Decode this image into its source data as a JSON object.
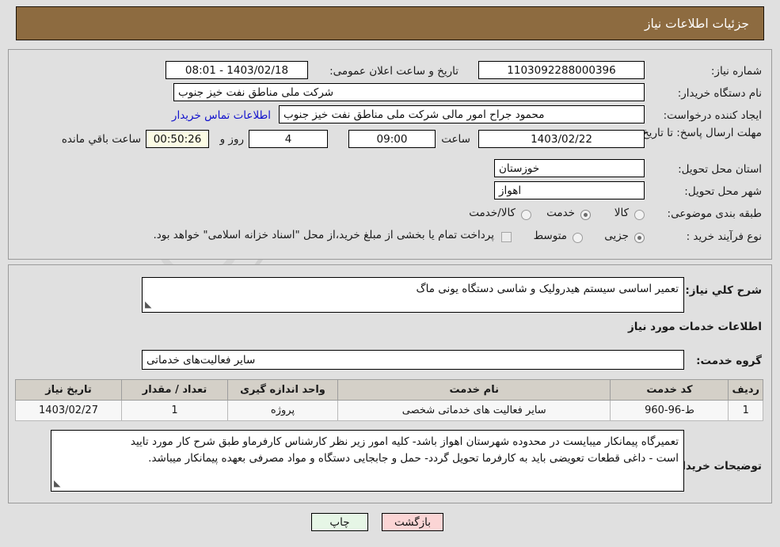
{
  "header": {
    "title": "جزئیات اطلاعات نیاز"
  },
  "top_section": {
    "need_number": {
      "label": "شماره نیاز:",
      "value": "1103092288000396"
    },
    "public_announce": {
      "label": "تاریخ و ساعت اعلان عمومی:",
      "value": "1403/02/18 - 08:01"
    },
    "buyer_org": {
      "label": "نام دستگاه خریدار:",
      "value": "شرکت ملی مناطق نفت خیز جنوب"
    },
    "request_creator": {
      "label": "ایجاد کننده درخواست:",
      "value": "محمود جراح امور مالی شرکت ملی مناطق نفت خیز جنوب"
    },
    "buyer_contact_link": "اطلاعات تماس خریدار",
    "deadline": {
      "label": "مهلت ارسال پاسخ: تا تاریخ:",
      "date": "1403/02/22",
      "time_label": "ساعت",
      "time": "09:00",
      "days": "4",
      "days_label": "روز و",
      "countdown": "00:50:26",
      "countdown_label": "ساعت باقي مانده"
    },
    "province": {
      "label": "استان محل تحویل:",
      "value": "خوزستان"
    },
    "city": {
      "label": "شهر محل تحویل:",
      "value": "اهواز"
    },
    "category": {
      "label": "طبقه بندی موضوعی:",
      "options": [
        "کالا",
        "خدمت",
        "کالا/خدمت"
      ],
      "selected": "خدمت"
    },
    "purchase_type": {
      "label": "نوع فرآیند خرید :",
      "options": [
        "جزیی",
        "متوسط"
      ],
      "selected": "جزیی"
    },
    "treasury_note": {
      "checked": false,
      "text": "پرداخت تمام یا بخشی از مبلغ خرید،از محل \"اسناد خزانه اسلامی\" خواهد بود."
    }
  },
  "bottom_section": {
    "general_desc": {
      "label": "شرح کلي نياز:",
      "value": "تعمیر اساسی سیستم هیدرولیک و شاسی دستگاه یونی ماگ"
    },
    "services_heading": "اطلاعات خدمات مورد نیاز",
    "service_group": {
      "label": "گروه خدمت:",
      "value": "سایر فعالیت‌های خدماتی"
    },
    "table": {
      "columns": [
        "ردیف",
        "کد خدمت",
        "نام خدمت",
        "واحد اندازه گیری",
        "تعداد / مقدار",
        "تاریخ نیاز"
      ],
      "rows": [
        {
          "row_no": "1",
          "service_code": "ط-96-960",
          "service_name": "سایر فعالیت های خدماتی شخصی",
          "unit": "پروژه",
          "quantity": "1",
          "need_date": "1403/02/27"
        }
      ]
    },
    "buyer_notes": {
      "label": "توضیحات خریدار:",
      "line1": "تعمیرگاه پیمانکار میبایست در محدوده شهرستان اهواز باشد- کلیه امور زیر نظر کارشناس کارفرماو طبق شرح کار مورد تایید",
      "line2": "است - داغی قطعات تعویضی باید به کارفرما تحویل گردد- حمل و جابجایی دستگاه و مواد مصرفی بعهده پیمانکار میباشد."
    }
  },
  "footer": {
    "print_button": "چاپ",
    "back_button": "بازگشت"
  },
  "watermark": {
    "text": "AriaTender.net"
  },
  "colors": {
    "header_bg": "#8d6b40",
    "page_bg": "#e0e0e0",
    "link": "#1111cc",
    "print_btn": "#e6f6e6",
    "back_btn": "#fbd5d5",
    "countdown_bg": "#fbfbe4",
    "table_header": "#d4d0c8"
  }
}
